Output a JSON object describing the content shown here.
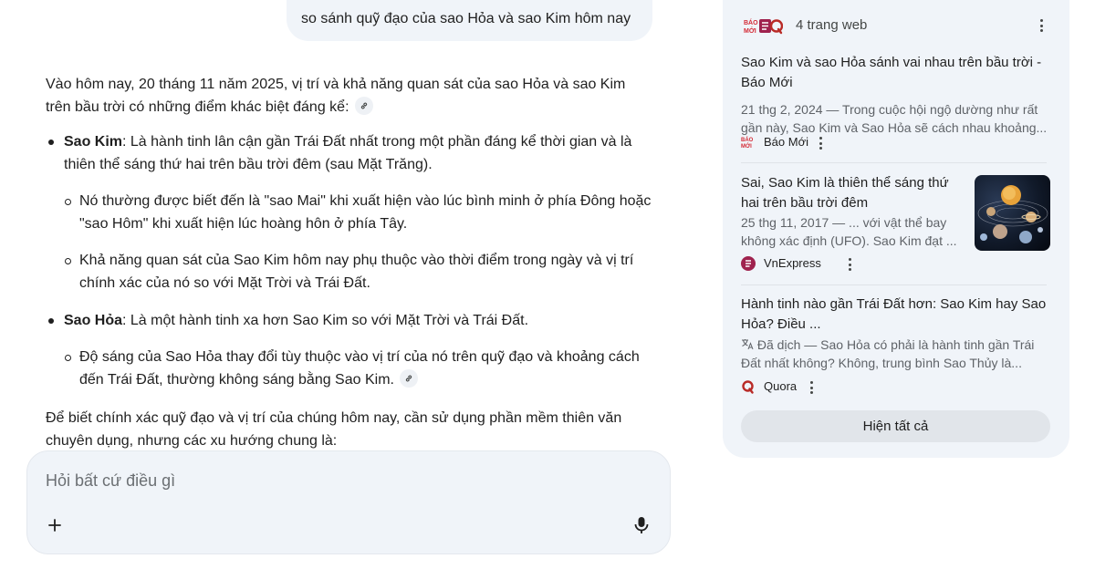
{
  "user_message": "so sánh quỹ đạo của sao Hỏa và sao Kim hôm nay",
  "answer": {
    "intro": "Vào hôm nay, 20 tháng 11 năm 2025, vị trí và khả năng quan sát của sao Hỏa và sao Kim trên bầu trời có những điểm khác biệt đáng kể:",
    "venus": {
      "label": "Sao Kim",
      "text": ": Là hành tinh lân cận gần Trái Đất nhất trong một phần đáng kể thời gian và là thiên thể sáng thứ hai trên bầu trời đêm (sau Mặt Trăng).",
      "sub": [
        "Nó thường được biết đến là \"sao Mai\" khi xuất hiện vào lúc bình minh ở phía Đông hoặc \"sao Hôm\" khi xuất hiện lúc hoàng hôn ở phía Tây.",
        "Khả năng quan sát của Sao Kim hôm nay phụ thuộc vào thời điểm trong ngày và vị trí chính xác của nó so với Mặt Trời và Trái Đất."
      ]
    },
    "mars": {
      "label": "Sao Hỏa",
      "text": ": Là một hành tinh xa hơn Sao Kim so với Mặt Trời và Trái Đất.",
      "sub": [
        "Độ sáng của Sao Hỏa thay đổi tùy thuộc vào vị trí của nó trên quỹ đạo và khoảng cách đến Trái Đất, thường không sáng bằng Sao Kim."
      ]
    },
    "outro": "Để biết chính xác quỹ đạo và vị trí của chúng hôm nay, cần sử dụng phần mềm thiên văn chuyên dụng, nhưng các xu hướng chung là:"
  },
  "input": {
    "placeholder": "Hỏi bất cứ điều gì"
  },
  "sources": {
    "count_label": "4 trang web",
    "items": [
      {
        "title": "Sao Kim và sao Hỏa sánh vai nhau trên bầu trời - Báo Mới",
        "snippet": "21 thg 2, 2024 — Trong cuộc hội ngộ dường như rất gần này, Sao Kim và Sao Hỏa sẽ cách nhau khoảng...",
        "site": "Báo Mới"
      },
      {
        "title": "Sai, Sao Kim là thiên thể sáng thứ hai trên bầu trời đêm",
        "snippet": "25 thg 11, 2017 — ... với vật thể bay không xác định (UFO). Sao Kim đạt ...",
        "site": "VnExpress"
      },
      {
        "title": "Hành tinh nào gần Trái Đất hơn: Sao Kim hay Sao Hỏa? Điều ...",
        "snippet": "Đã dịch — Sao Hỏa có phải là hành tinh gần Trái Đất nhất không? Không, trung bình Sao Thủy là...",
        "site": "Quora"
      }
    ],
    "show_all_label": "Hiện tất cả"
  },
  "colors": {
    "surface": "#f0f4f9",
    "text": "#1f1f1f",
    "muted": "#5f6368",
    "baomoi_red": "#d42a35",
    "vnexpress": "#9f224e",
    "quora": "#b92b27"
  }
}
